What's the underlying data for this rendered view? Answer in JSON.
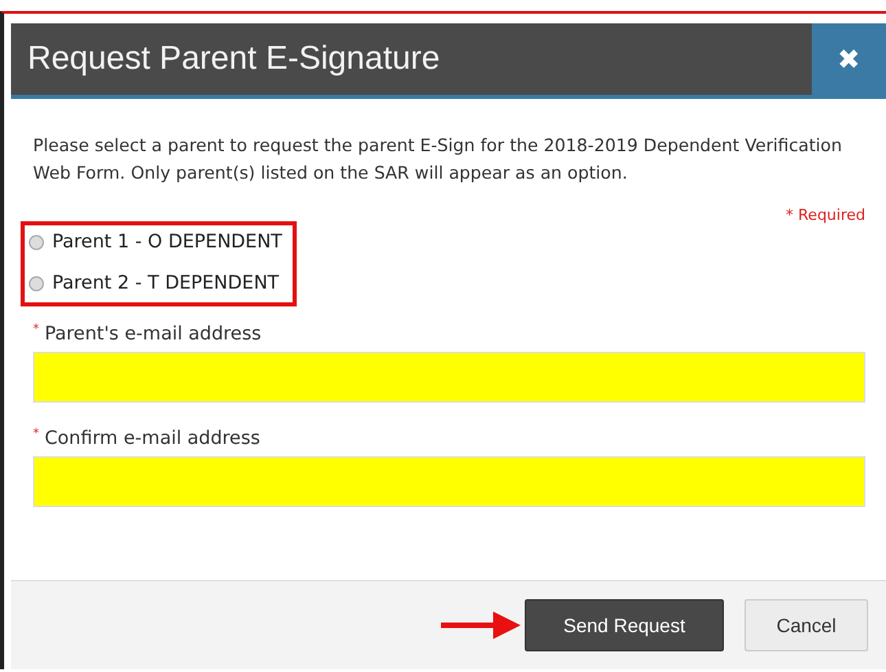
{
  "dialog": {
    "title": "Request Parent E-Signature",
    "close_icon": "✖"
  },
  "intro": "Please select a parent to request the parent E-Sign for the 2018-2019 Dependent Verification Web Form. Only parent(s) listed on the SAR will appear as an option.",
  "required_note": "* Required",
  "parents": [
    {
      "label": "Parent 1 - O DEPENDENT",
      "selected": false
    },
    {
      "label": "Parent 2 - T DEPENDENT",
      "selected": false
    }
  ],
  "fields": [
    {
      "label": "Parent's e-mail address",
      "required_mark": "*"
    },
    {
      "label": "Confirm e-mail address",
      "required_mark": "*"
    }
  ],
  "buttons": [
    {
      "label": "Send Request",
      "kind": "primary"
    },
    {
      "label": "Cancel",
      "kind": "secondary"
    }
  ]
}
